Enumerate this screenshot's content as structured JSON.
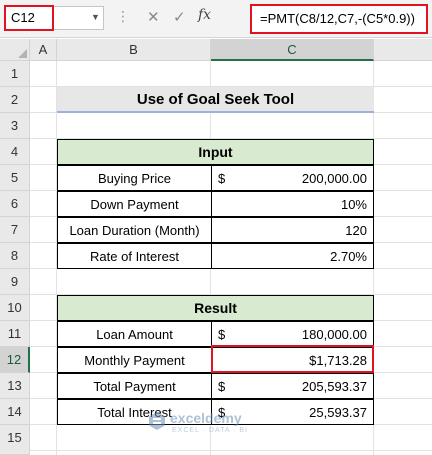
{
  "formula_bar": {
    "name_box": "C12",
    "formula": "=PMT(C8/12,C7,-(C5*0.9))",
    "fx_label": "fx"
  },
  "columns": [
    "A",
    "B",
    "C"
  ],
  "rows": [
    "1",
    "2",
    "3",
    "4",
    "5",
    "6",
    "7",
    "8",
    "9",
    "10",
    "11",
    "12",
    "13",
    "14",
    "15"
  ],
  "title": "Use of Goal Seek Tool",
  "input_table": {
    "header": "Input",
    "rows": [
      {
        "label": "Buying Price",
        "currency": "$",
        "value": "200,000.00"
      },
      {
        "label": "Down Payment",
        "currency": "",
        "value": "10%"
      },
      {
        "label": "Loan Duration (Month)",
        "currency": "",
        "value": "120"
      },
      {
        "label": "Rate of Interest",
        "currency": "",
        "value": "2.70%"
      }
    ]
  },
  "result_table": {
    "header": "Result",
    "rows": [
      {
        "label": "Loan Amount",
        "currency": "$",
        "value": "180,000.00"
      },
      {
        "label": "Monthly Payment",
        "currency": "",
        "value": "$1,713.28"
      },
      {
        "label": "Total Payment",
        "currency": "$",
        "value": "205,593.37"
      },
      {
        "label": "Total Interest",
        "currency": "$",
        "value": "25,593.37"
      }
    ]
  },
  "watermark": {
    "name": "exceldemy",
    "tagline": "EXCEL · DATA · BI"
  },
  "colors": {
    "accent_green": "#217346",
    "highlight_red": "#e0141e",
    "header_fill": "#d8ead0"
  }
}
